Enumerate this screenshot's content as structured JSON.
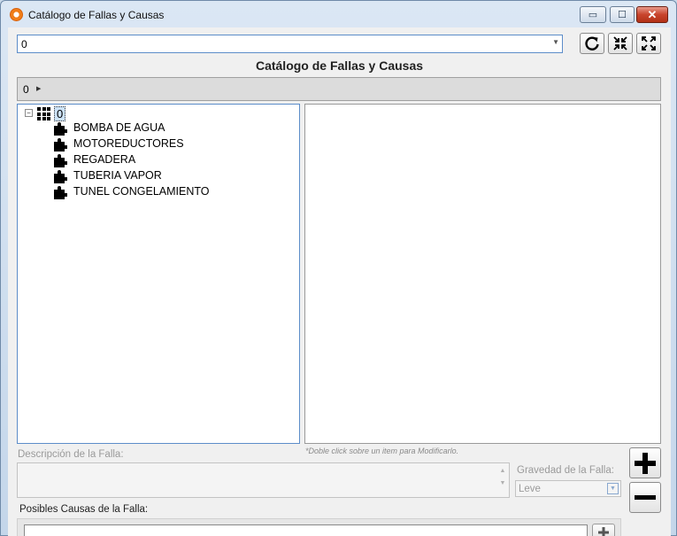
{
  "window": {
    "title": "Catálogo de Fallas y Causas",
    "controls": {
      "minimize": "▭",
      "maximize": "☐",
      "close": "✕"
    }
  },
  "toolbar": {
    "selector_value": "0",
    "refresh_icon": "refresh-icon",
    "collapse_icon": "collapse-icon",
    "expand_icon": "expand-icon"
  },
  "header": {
    "title": "Catálogo de Fallas y Causas"
  },
  "breadcrumb": {
    "items": [
      "0"
    ]
  },
  "tree": {
    "root": {
      "label": "0",
      "expanded": true,
      "icon": "grid-icon"
    },
    "children": [
      {
        "label": "BOMBA DE AGUA",
        "icon": "puzzle-icon"
      },
      {
        "label": "MOTOREDUCTORES",
        "icon": "puzzle-icon"
      },
      {
        "label": "REGADERA",
        "icon": "puzzle-icon"
      },
      {
        "label": "TUBERIA VAPOR",
        "icon": "puzzle-icon"
      },
      {
        "label": "TUNEL CONGELAMIENTO",
        "icon": "puzzle-icon"
      }
    ]
  },
  "form": {
    "hint": "*Doble click sobre un item para Modificarlo.",
    "description_label": "Descripción de la Falla:",
    "description_value": "",
    "severity_label": "Gravedad de la Falla:",
    "severity_value": "Leve",
    "causes_label": "Posibles Causas de la Falla:",
    "causes_value": ""
  },
  "colors": {
    "accent_border": "#5c8dc9",
    "selection": "#cde3f8",
    "close_button": "#c8442c"
  }
}
